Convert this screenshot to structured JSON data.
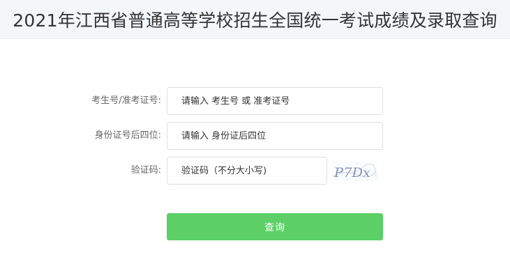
{
  "header": {
    "title": "2021年江西省普通高等学校招生全国统一考试成绩及录取查询"
  },
  "form": {
    "exam_id": {
      "label": "考生号/准考证号:",
      "placeholder": "请输入 考生号 或 准考证号"
    },
    "id_last4": {
      "label": "身份证号后四位:",
      "placeholder": "请输入 身份证后四位"
    },
    "captcha": {
      "label": "验证码:",
      "placeholder": "验证码（不分大小写)",
      "image_text": "P7Dx"
    },
    "submit_label": "查询"
  },
  "colors": {
    "primary_button": "#5cd067",
    "header_bg": "#f4f7fa"
  }
}
